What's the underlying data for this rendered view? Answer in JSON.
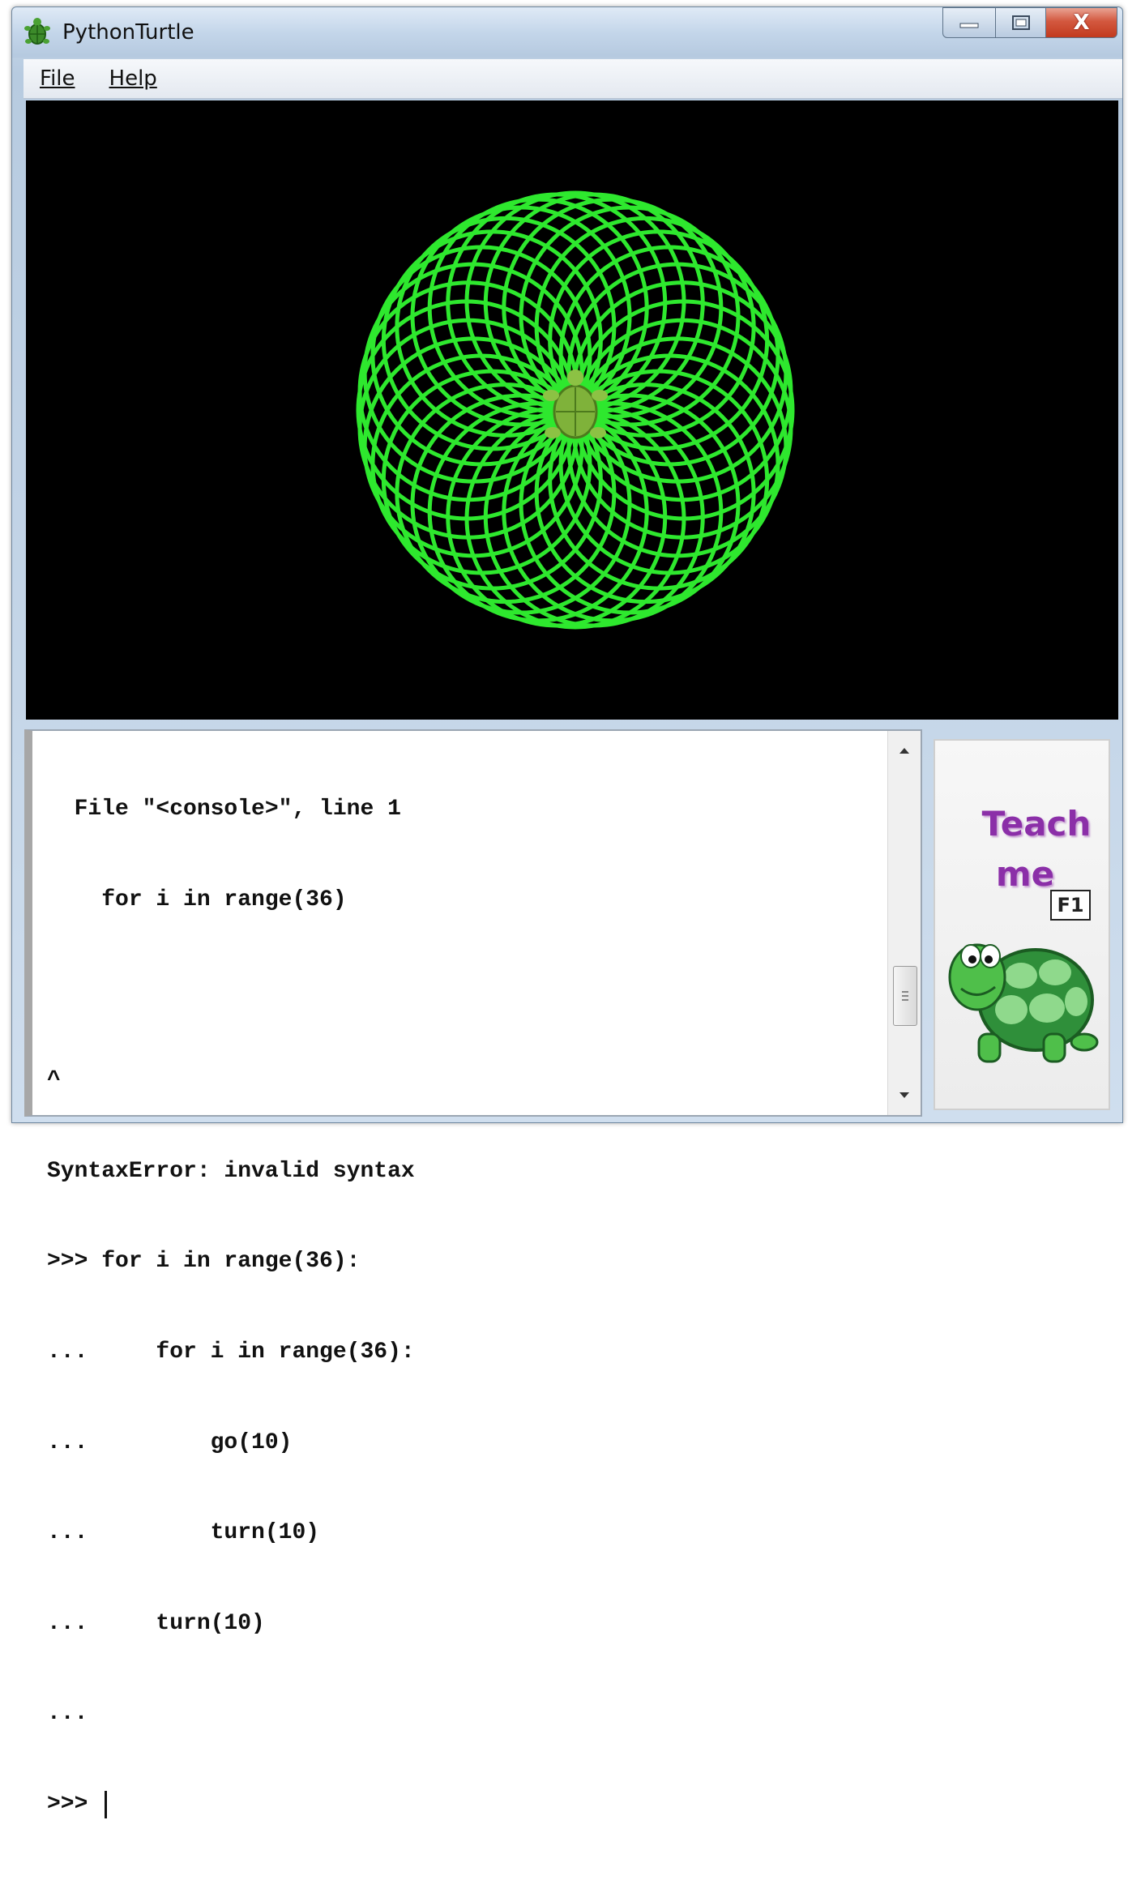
{
  "window": {
    "title": "PythonTurtle",
    "app_icon": "turtle-icon",
    "controls": [
      "minimize-icon",
      "maximize-icon",
      "close-icon"
    ],
    "close_glyph": "X"
  },
  "menu": {
    "file_label": "File",
    "help_label": "Help"
  },
  "canvas": {
    "background": "#000000",
    "line_color": "#2ee82e",
    "turtle_color": "#7fb23a",
    "pattern_circles": 36
  },
  "console": {
    "lines": [
      "  File \"<console>\", line 1",
      "    for i in range(36)",
      "",
      "^",
      "SyntaxError: invalid syntax",
      ">>> for i in range(36):",
      "...     for i in range(36):",
      "...         go(10)",
      "...         turn(10)",
      "...     turn(10)",
      "..."
    ],
    "prompt": ">>> "
  },
  "teach_panel": {
    "line1": "Teach",
    "line2": "me",
    "shortcut": "F1",
    "text_color": "#8b2fa8",
    "mascot": "cartoon-turtle"
  }
}
